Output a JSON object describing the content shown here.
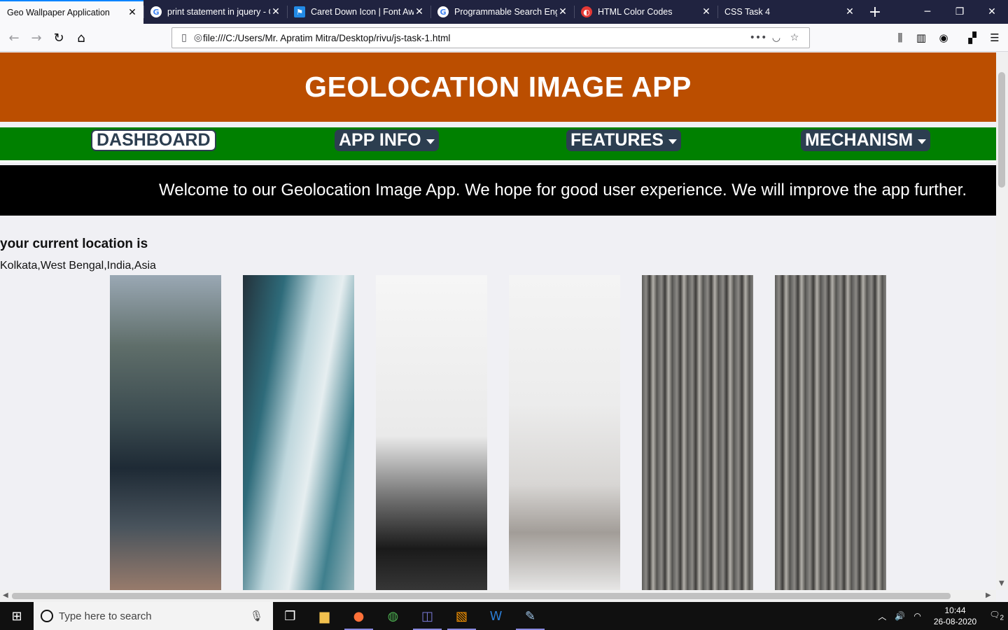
{
  "browser": {
    "tabs": [
      {
        "title": "Geo Wallpaper Application",
        "icon": "none",
        "active": true
      },
      {
        "title": "print statement in jquery - G",
        "icon": "google-icon"
      },
      {
        "title": "Caret Down Icon | Font Aweso",
        "icon": "fontawesome-flag-icon"
      },
      {
        "title": "Programmable Search Engine",
        "icon": "google-icon"
      },
      {
        "title": "HTML Color Codes",
        "icon": "html-color-codes-icon"
      },
      {
        "title": "CSS Task 4",
        "icon": "none"
      }
    ],
    "url": "file:///C:/Users/Mr. Apratim Mitra/Desktop/rivu/js-task-1.html"
  },
  "page": {
    "header_title": "GEOLOCATION IMAGE APP",
    "menu": {
      "dashboard": "DASHBOARD",
      "app_info": "APP INFO",
      "features": "FEATURES",
      "mechanism": "MECHANISM"
    },
    "welcome": "Welcome to our Geolocation Image App. We hope for good user experience. We will improve the app further.",
    "location_heading": "your current location is",
    "location_value": "Kolkata,West Bengal,India,Asia",
    "images": [
      "car-photo",
      "car-window-photo",
      "power-line-photo",
      "blurred-photo",
      "tree-bark-photo",
      "tree-bark-photo"
    ]
  },
  "taskbar": {
    "search_placeholder": "Type here to search",
    "time": "10:44",
    "date": "26-08-2020",
    "notification_count": "2"
  },
  "colors": {
    "header_bg": "#bb4e00",
    "menu_bg": "#008000",
    "menu_item_bg": "#2c3e50",
    "welcome_bg": "#000000"
  }
}
